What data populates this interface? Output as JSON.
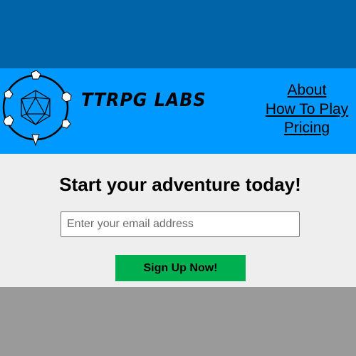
{
  "header": {
    "brand": "TTRPG LABS",
    "logo_icon": "dice-ring-logo-icon",
    "nav": [
      {
        "label": "About"
      },
      {
        "label": "How To Play"
      },
      {
        "label": "Pricing"
      }
    ]
  },
  "main": {
    "headline": "Start your adventure today!",
    "email_placeholder": "Enter your email address",
    "email_value": "",
    "signup_label": "Sign Up Now!"
  },
  "colors": {
    "top_band": "#0264a8",
    "header_bg": "#0099ff",
    "main_bg": "#eeeeee",
    "footer_bg": "#9a9a9a",
    "signup_button": "#00b050"
  }
}
